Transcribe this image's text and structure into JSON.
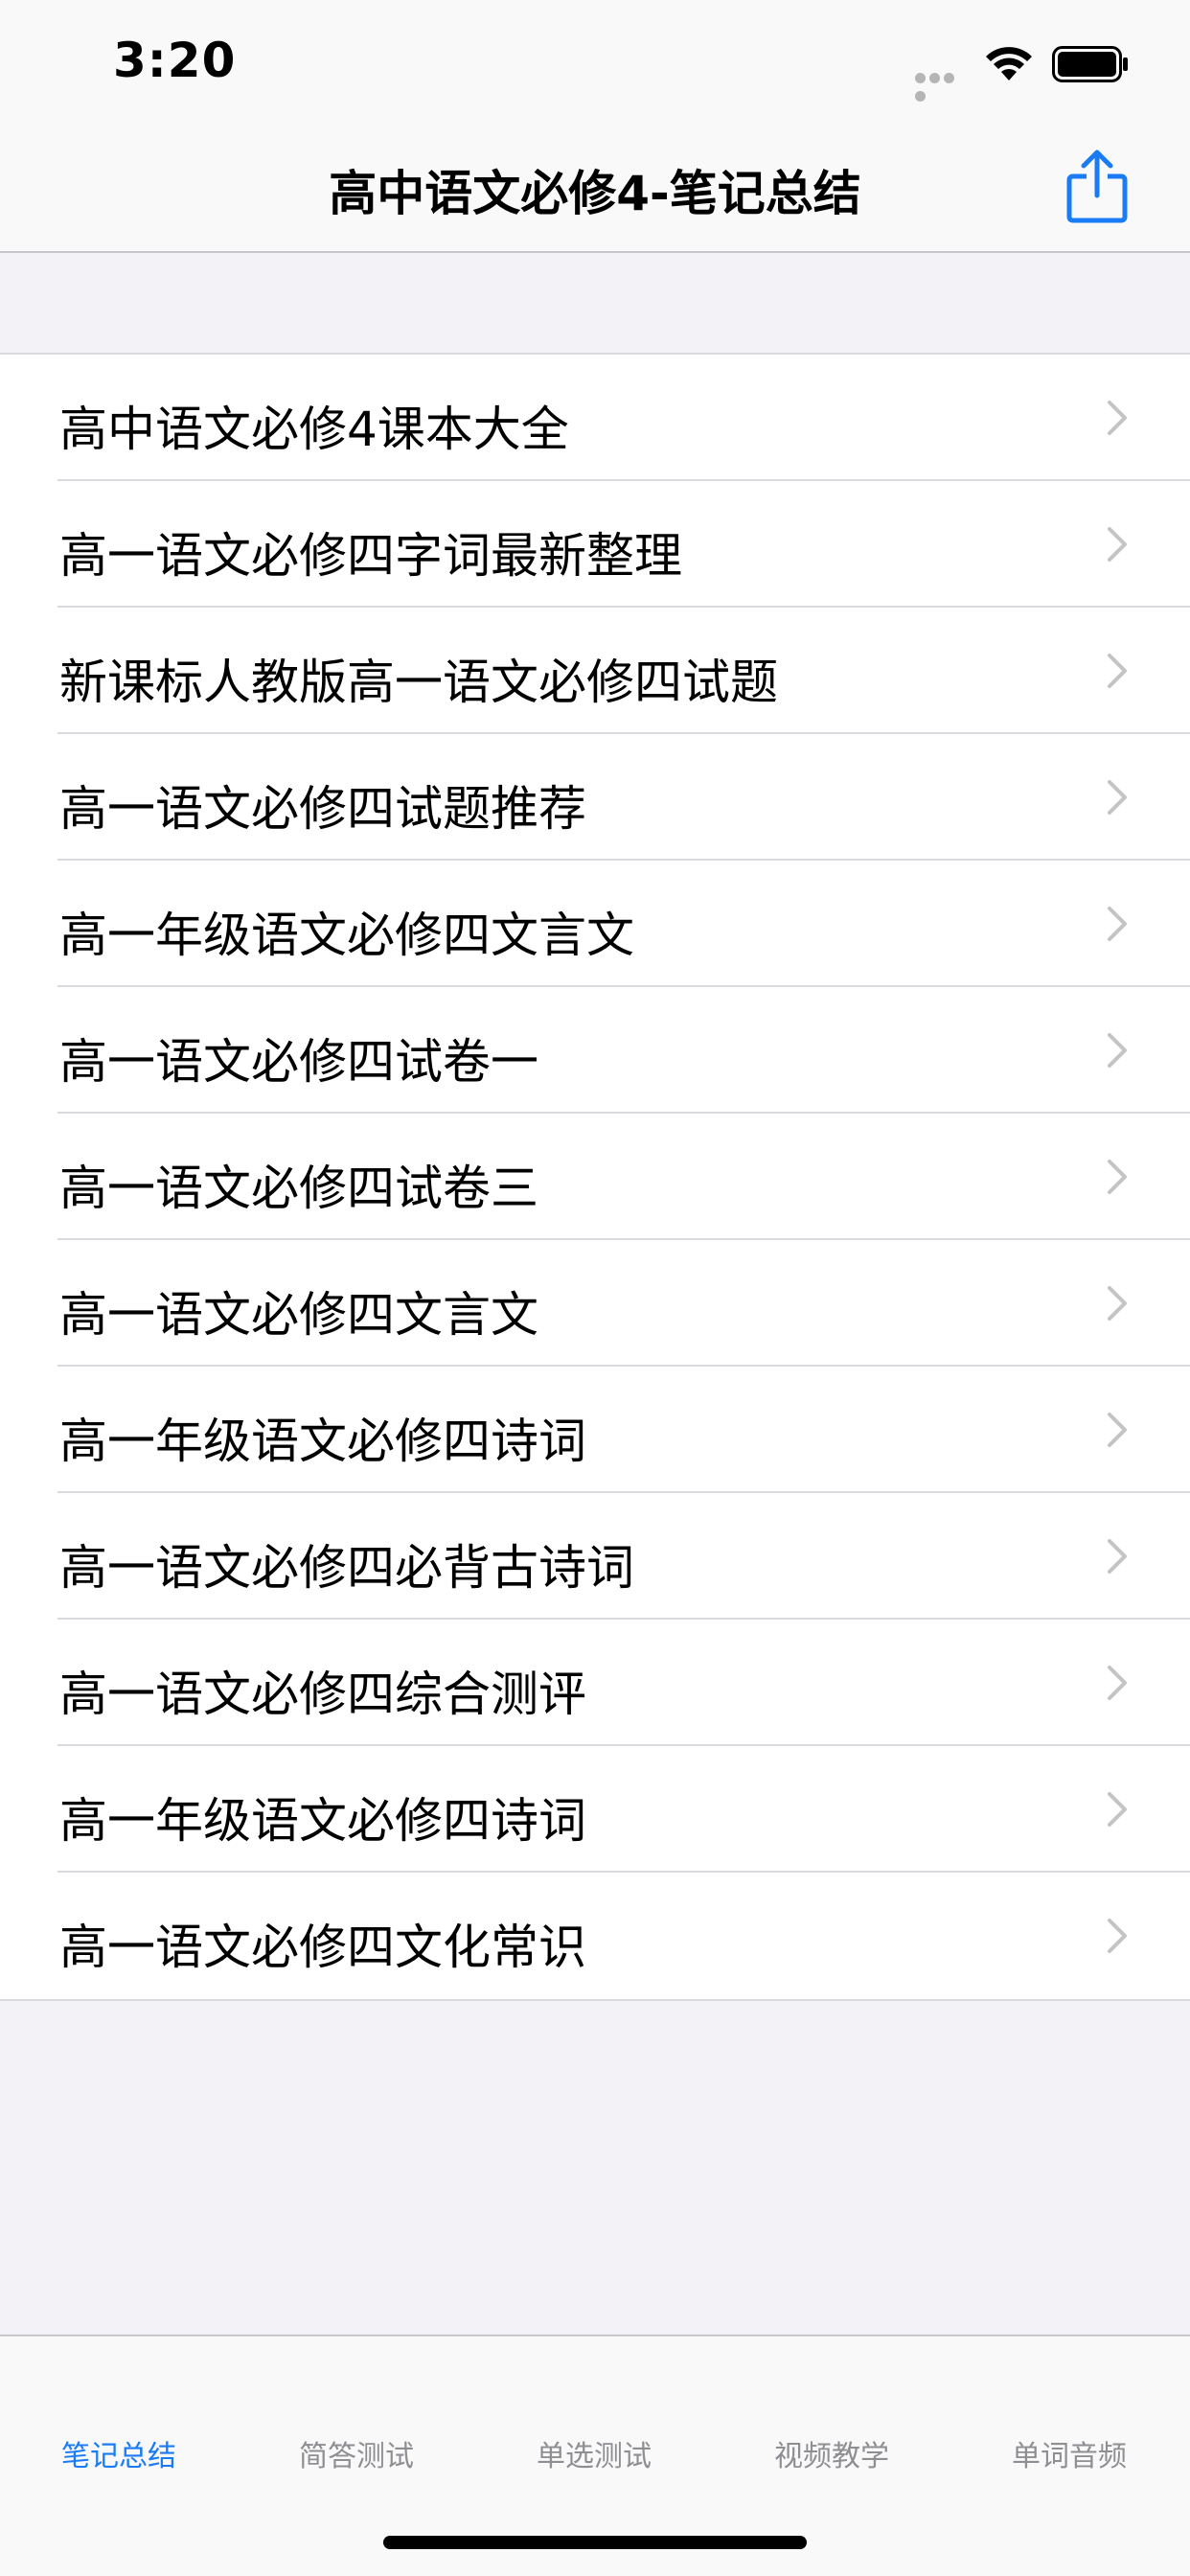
{
  "status_bar": {
    "time": "3:20"
  },
  "nav": {
    "title": "高中语文必修4-笔记总结",
    "share_icon": "share-icon"
  },
  "list": {
    "items": [
      {
        "label": "高中语文必修4课本大全"
      },
      {
        "label": "高一语文必修四字词最新整理"
      },
      {
        "label": "新课标人教版高一语文必修四试题"
      },
      {
        "label": "高一语文必修四试题推荐"
      },
      {
        "label": "高一年级语文必修四文言文"
      },
      {
        "label": "高一语文必修四试卷一"
      },
      {
        "label": "高一语文必修四试卷三"
      },
      {
        "label": "高一语文必修四文言文"
      },
      {
        "label": "高一年级语文必修四诗词"
      },
      {
        "label": "高一语文必修四必背古诗词"
      },
      {
        "label": "高一语文必修四综合测评"
      },
      {
        "label": "高一年级语文必修四诗词"
      },
      {
        "label": "高一语文必修四文化常识"
      }
    ]
  },
  "tabs": [
    {
      "label": "笔记总结",
      "active": true
    },
    {
      "label": "简答测试",
      "active": false
    },
    {
      "label": "单选测试",
      "active": false
    },
    {
      "label": "视频教学",
      "active": false
    },
    {
      "label": "单词音频",
      "active": false
    }
  ],
  "colors": {
    "accent": "#1a7cf5",
    "background": "#f2f2f7",
    "inactive_tab": "#8e8e93"
  }
}
